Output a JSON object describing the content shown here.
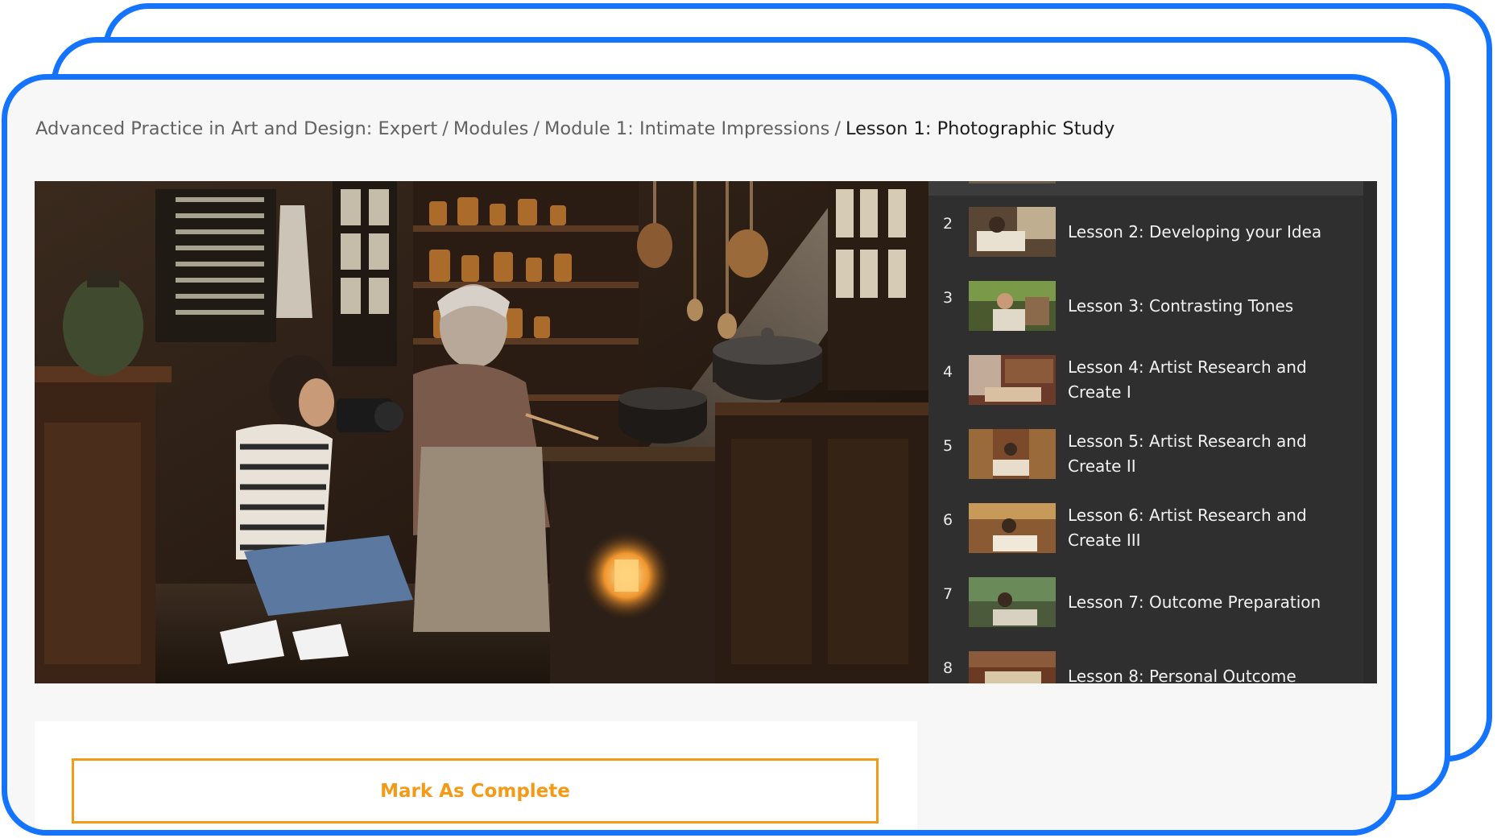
{
  "breadcrumb": {
    "items": [
      "Advanced Practice in Art and Design: Expert",
      "Modules",
      "Module 1: Intimate Impressions"
    ],
    "current": "Lesson 1: Photographic Study",
    "separator": "/"
  },
  "video": {
    "description_icon": "kitchen-photography-scene-image"
  },
  "lessons": [
    {
      "number": "2",
      "title": "Lesson 2: Developing your Idea"
    },
    {
      "number": "3",
      "title": "Lesson 3: Contrasting Tones"
    },
    {
      "number": "4",
      "title": "Lesson 4: Artist Research and Create I"
    },
    {
      "number": "5",
      "title": "Lesson 5: Artist Research and Create II"
    },
    {
      "number": "6",
      "title": "Lesson 6: Artist Research and Create III"
    },
    {
      "number": "7",
      "title": "Lesson 7: Outcome Preparation"
    },
    {
      "number": "8",
      "title": "Lesson 8: Personal Outcome"
    }
  ],
  "actions": {
    "mark_complete_label": "Mark As Complete"
  },
  "colors": {
    "frame_blue": "#1473ff",
    "accent_orange": "#f39a17",
    "panel_dark": "#2f2f2f"
  }
}
